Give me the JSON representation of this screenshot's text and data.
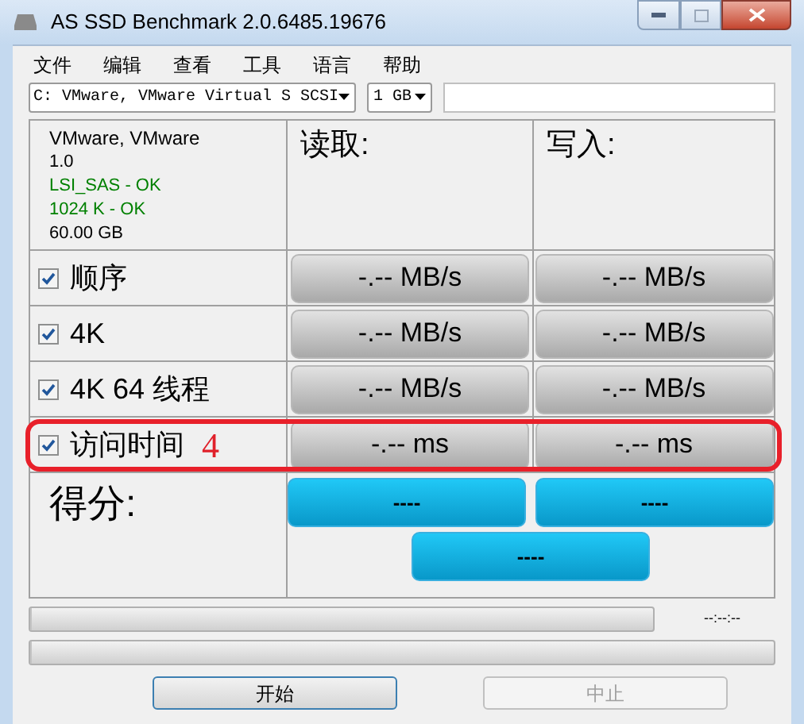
{
  "window": {
    "title": "AS SSD Benchmark 2.0.6485.19676"
  },
  "menu": [
    "文件",
    "编辑",
    "查看",
    "工具",
    "语言",
    "帮助"
  ],
  "drive_select": {
    "value": "C: VMware, VMware Virtual S SCSI"
  },
  "size_select": {
    "value": "1 GB"
  },
  "device_info": [
    {
      "text": "VMware, VMware",
      "color": "#000000"
    },
    {
      "text": "1.0",
      "color": "#000000"
    },
    {
      "text": "LSI_SAS - OK",
      "color": "#008000"
    },
    {
      "text": "1024 K - OK",
      "color": "#008000"
    },
    {
      "text": "60.00 GB",
      "color": "#000000"
    }
  ],
  "headers": {
    "read": "读取:",
    "write": "写入:"
  },
  "tests": [
    {
      "label": "顺序",
      "checked": true,
      "read": "-.-- MB/s",
      "write": "-.-- MB/s",
      "highlighted": false
    },
    {
      "label": "4K",
      "checked": true,
      "read": "-.-- MB/s",
      "write": "-.-- MB/s",
      "highlighted": false
    },
    {
      "label": "4K 64 线程",
      "checked": true,
      "read": "-.-- MB/s",
      "write": "-.-- MB/s",
      "highlighted": false
    },
    {
      "label": "访问时间",
      "checked": true,
      "read": "-.-- ms",
      "write": "-.-- ms",
      "highlighted": true,
      "annotation": "4"
    }
  ],
  "score": {
    "label": "得分:",
    "read": "----",
    "write": "----",
    "total": "----"
  },
  "progress": [
    {
      "level": 0,
      "time": "--:--:--"
    },
    {
      "level": 0
    }
  ],
  "buttons": [
    {
      "label": "开始",
      "disabled": false,
      "selected": true
    },
    {
      "label": "中止",
      "disabled": true,
      "selected": false
    }
  ]
}
